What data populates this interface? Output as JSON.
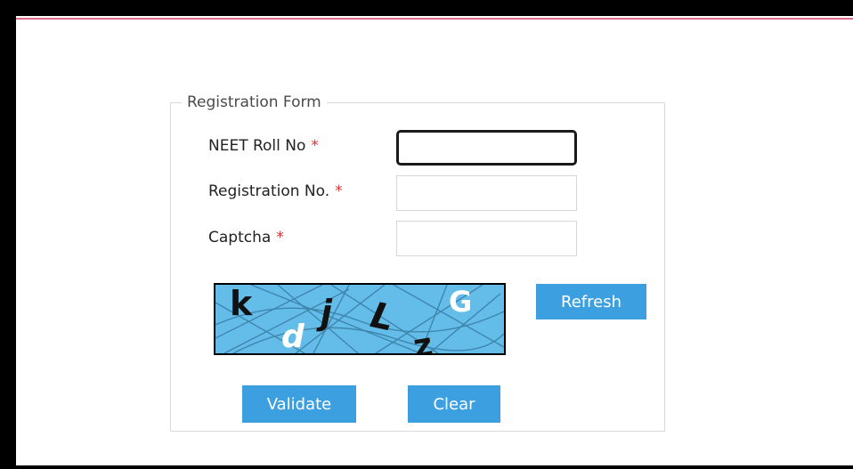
{
  "form": {
    "legend": "Registration Form",
    "required_marker": "*",
    "fields": [
      {
        "label": "NEET Roll No",
        "value": "",
        "placeholder": ""
      },
      {
        "label": "Registration No.",
        "value": "",
        "placeholder": ""
      },
      {
        "label": "Captcha",
        "value": "",
        "placeholder": ""
      }
    ],
    "captcha": {
      "characters": [
        "k",
        "d",
        "j",
        "L",
        "z",
        "G"
      ]
    },
    "buttons": {
      "refresh": "Refresh",
      "validate": "Validate",
      "clear": "Clear"
    }
  },
  "colors": {
    "button_bg": "#3c9fe0",
    "captcha_bg": "#64bde8",
    "required": "#e0312a",
    "top_rule": "#e06b8b"
  }
}
